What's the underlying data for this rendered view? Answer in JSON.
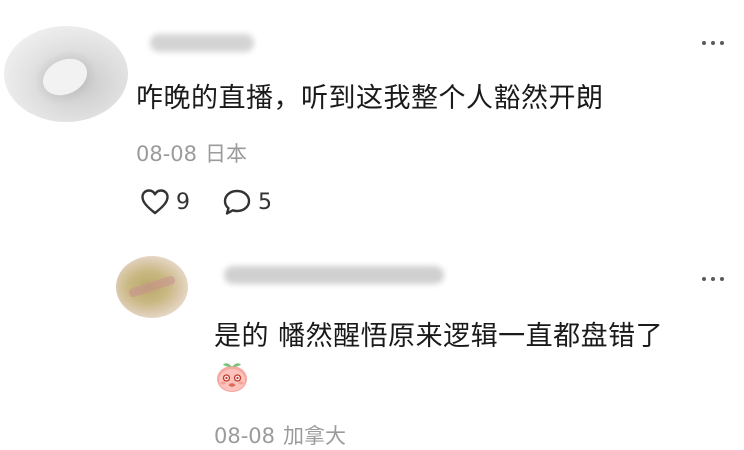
{
  "comment": {
    "text": "咋晚的直播，听到这我整个人豁然开朗",
    "date": "08-08",
    "location": "日本",
    "likes": "9",
    "replies": "5"
  },
  "reply": {
    "text": "是的 幡然醒悟原来逻辑一直都盘错了",
    "emoji": "peach-face-emoji",
    "date": "08-08",
    "location": "加拿大"
  },
  "icons": {
    "like": "heart-outline-icon",
    "reply": "speech-bubble-icon",
    "more": "more-dots-icon"
  }
}
